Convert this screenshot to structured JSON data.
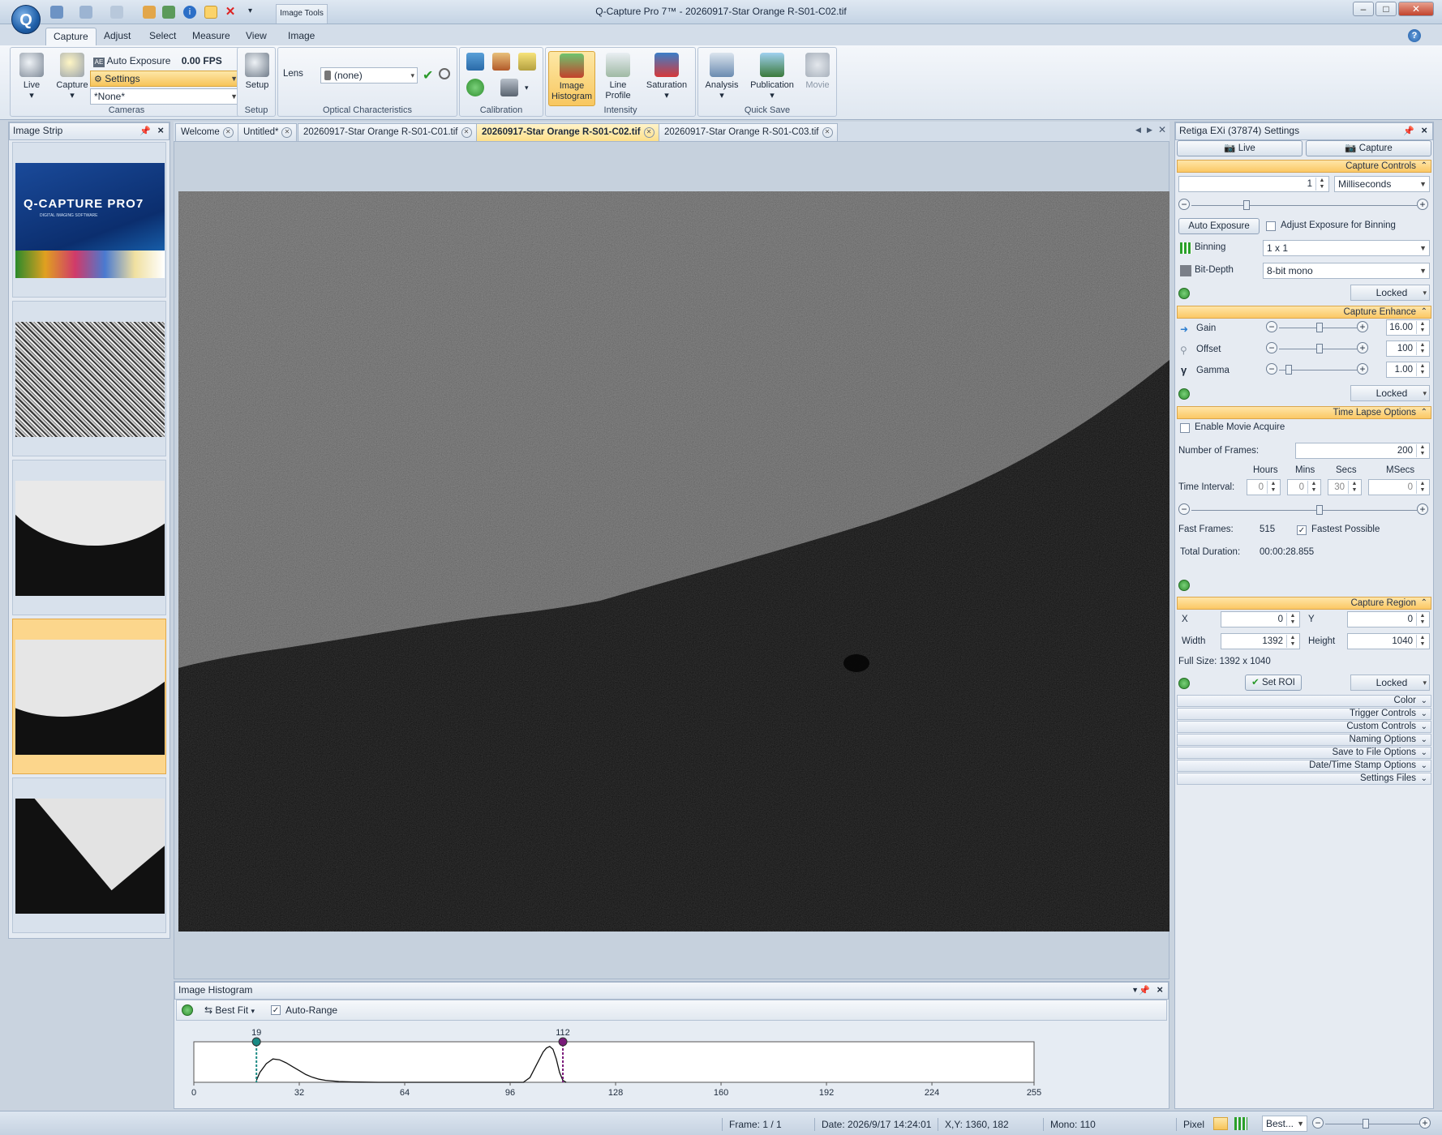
{
  "window": {
    "title": "Q-Capture Pro 7™ - 20260917-Star Orange R-S01-C02.tif",
    "context_tab": "Image Tools"
  },
  "ribbon_tabs": [
    "Capture",
    "Adjust",
    "Select",
    "Measure",
    "View",
    "Image"
  ],
  "ribbon": {
    "cameras": {
      "live": "Live",
      "capture": "Capture",
      "auto_exposure": "Auto Exposure",
      "fps": "0.00 FPS",
      "settings": "Settings",
      "preset": "*None*",
      "label": "Cameras"
    },
    "setup": {
      "button": "Setup",
      "label": "Setup"
    },
    "optical": {
      "lens_label": "Lens",
      "lens_value": "(none)",
      "label": "Optical Characteristics"
    },
    "calibration": {
      "label": "Calibration"
    },
    "intensity": {
      "image_histogram": "Image Histogram",
      "line_profile": "Line Profile",
      "saturation": "Saturation",
      "label": "Intensity"
    },
    "quick_save": {
      "analysis": "Analysis",
      "publication": "Publication",
      "movie": "Movie",
      "label": "Quick Save"
    }
  },
  "image_strip": {
    "title": "Image Strip",
    "splash_title": "Q-CAPTURE PRO7",
    "splash_sub": "DIGITAL IMAGING SOFTWARE"
  },
  "doc_tabs": [
    "Welcome",
    "Untitled*",
    "20260917-Star Orange R-S01-C01.tif",
    "20260917-Star Orange R-S01-C02.tif",
    "20260917-Star Orange R-S01-C03.tif"
  ],
  "histogram": {
    "title": "Image Histogram",
    "best_fit": "Best Fit",
    "auto_range": "Auto-Range",
    "chart_data": {
      "type": "area",
      "x_ticks": [
        0,
        32,
        64,
        96,
        128,
        160,
        192,
        224,
        255
      ],
      "xlim": [
        0,
        255
      ],
      "markers": [
        {
          "value": 19,
          "color": "#1a8a84"
        },
        {
          "value": 112,
          "color": "#7a1a7a"
        }
      ],
      "marker_labels": [
        "19",
        "112"
      ],
      "series": [
        {
          "x": [
            19,
            20,
            22,
            24,
            26,
            28,
            30,
            32,
            34,
            36,
            38,
            40,
            44,
            48,
            52,
            56,
            60,
            100,
            102,
            104,
            106,
            107,
            108,
            109,
            110,
            111,
            112,
            113
          ],
          "y": [
            0.05,
            0.25,
            0.48,
            0.6,
            0.58,
            0.5,
            0.4,
            0.3,
            0.2,
            0.13,
            0.08,
            0.05,
            0.02,
            0.01,
            0.005,
            0.0,
            0.0,
            0.0,
            0.12,
            0.45,
            0.78,
            0.88,
            0.92,
            0.85,
            0.6,
            0.25,
            0.05,
            0.0
          ]
        }
      ]
    }
  },
  "settings": {
    "title": "Retiga EXi (37874) Settings",
    "live_btn": "Live",
    "capture_btn": "Capture",
    "capture_controls": {
      "header": "Capture Controls",
      "exposure": "1",
      "units": "Milliseconds",
      "auto_exposure": "Auto Exposure",
      "adjust_binning": "Adjust Exposure for Binning",
      "binning_label": "Binning",
      "binning": "1 x 1",
      "bitdepth_label": "Bit-Depth",
      "bitdepth": "8-bit mono",
      "locked": "Locked"
    },
    "capture_enhance": {
      "header": "Capture Enhance",
      "gain_label": "Gain",
      "gain": "16.00",
      "offset_label": "Offset",
      "offset": "100",
      "gamma_label": "Gamma",
      "gamma": "1.00",
      "locked": "Locked"
    },
    "time_lapse": {
      "header": "Time Lapse Options",
      "enable_movie": "Enable Movie Acquire",
      "frames_label": "Number of Frames:",
      "frames": "200",
      "hours_hdr": "Hours",
      "mins_hdr": "Mins",
      "secs_hdr": "Secs",
      "msecs_hdr": "MSecs",
      "interval_label": "Time Interval:",
      "hours": "0",
      "mins": "0",
      "secs": "30",
      "msecs": "0",
      "fast_frames_label": "Fast Frames:",
      "fast_frames": "515",
      "fastest": "Fastest Possible",
      "duration_label": "Total Duration:",
      "duration": "00:00:28.855"
    },
    "capture_region": {
      "header": "Capture Region",
      "x_label": "X",
      "x": "0",
      "y_label": "Y",
      "y": "0",
      "width_label": "Width",
      "width": "1392",
      "height_label": "Height",
      "height": "1040",
      "full_size": "Full Size: 1392 x 1040",
      "set_roi": "Set ROI",
      "locked": "Locked"
    },
    "collapsed": [
      "Color",
      "Trigger Controls",
      "Custom Controls",
      "Naming Options",
      "Save to File Options",
      "Date/Time Stamp Options",
      "Settings Files"
    ]
  },
  "status": {
    "frame": "Frame: 1 / 1",
    "date": "Date: 2026/9/17 14:24:01",
    "xy": "X,Y: 1360,  182",
    "mono": "Mono:  110",
    "pixel": "Pixel",
    "zoom": "Best..."
  }
}
